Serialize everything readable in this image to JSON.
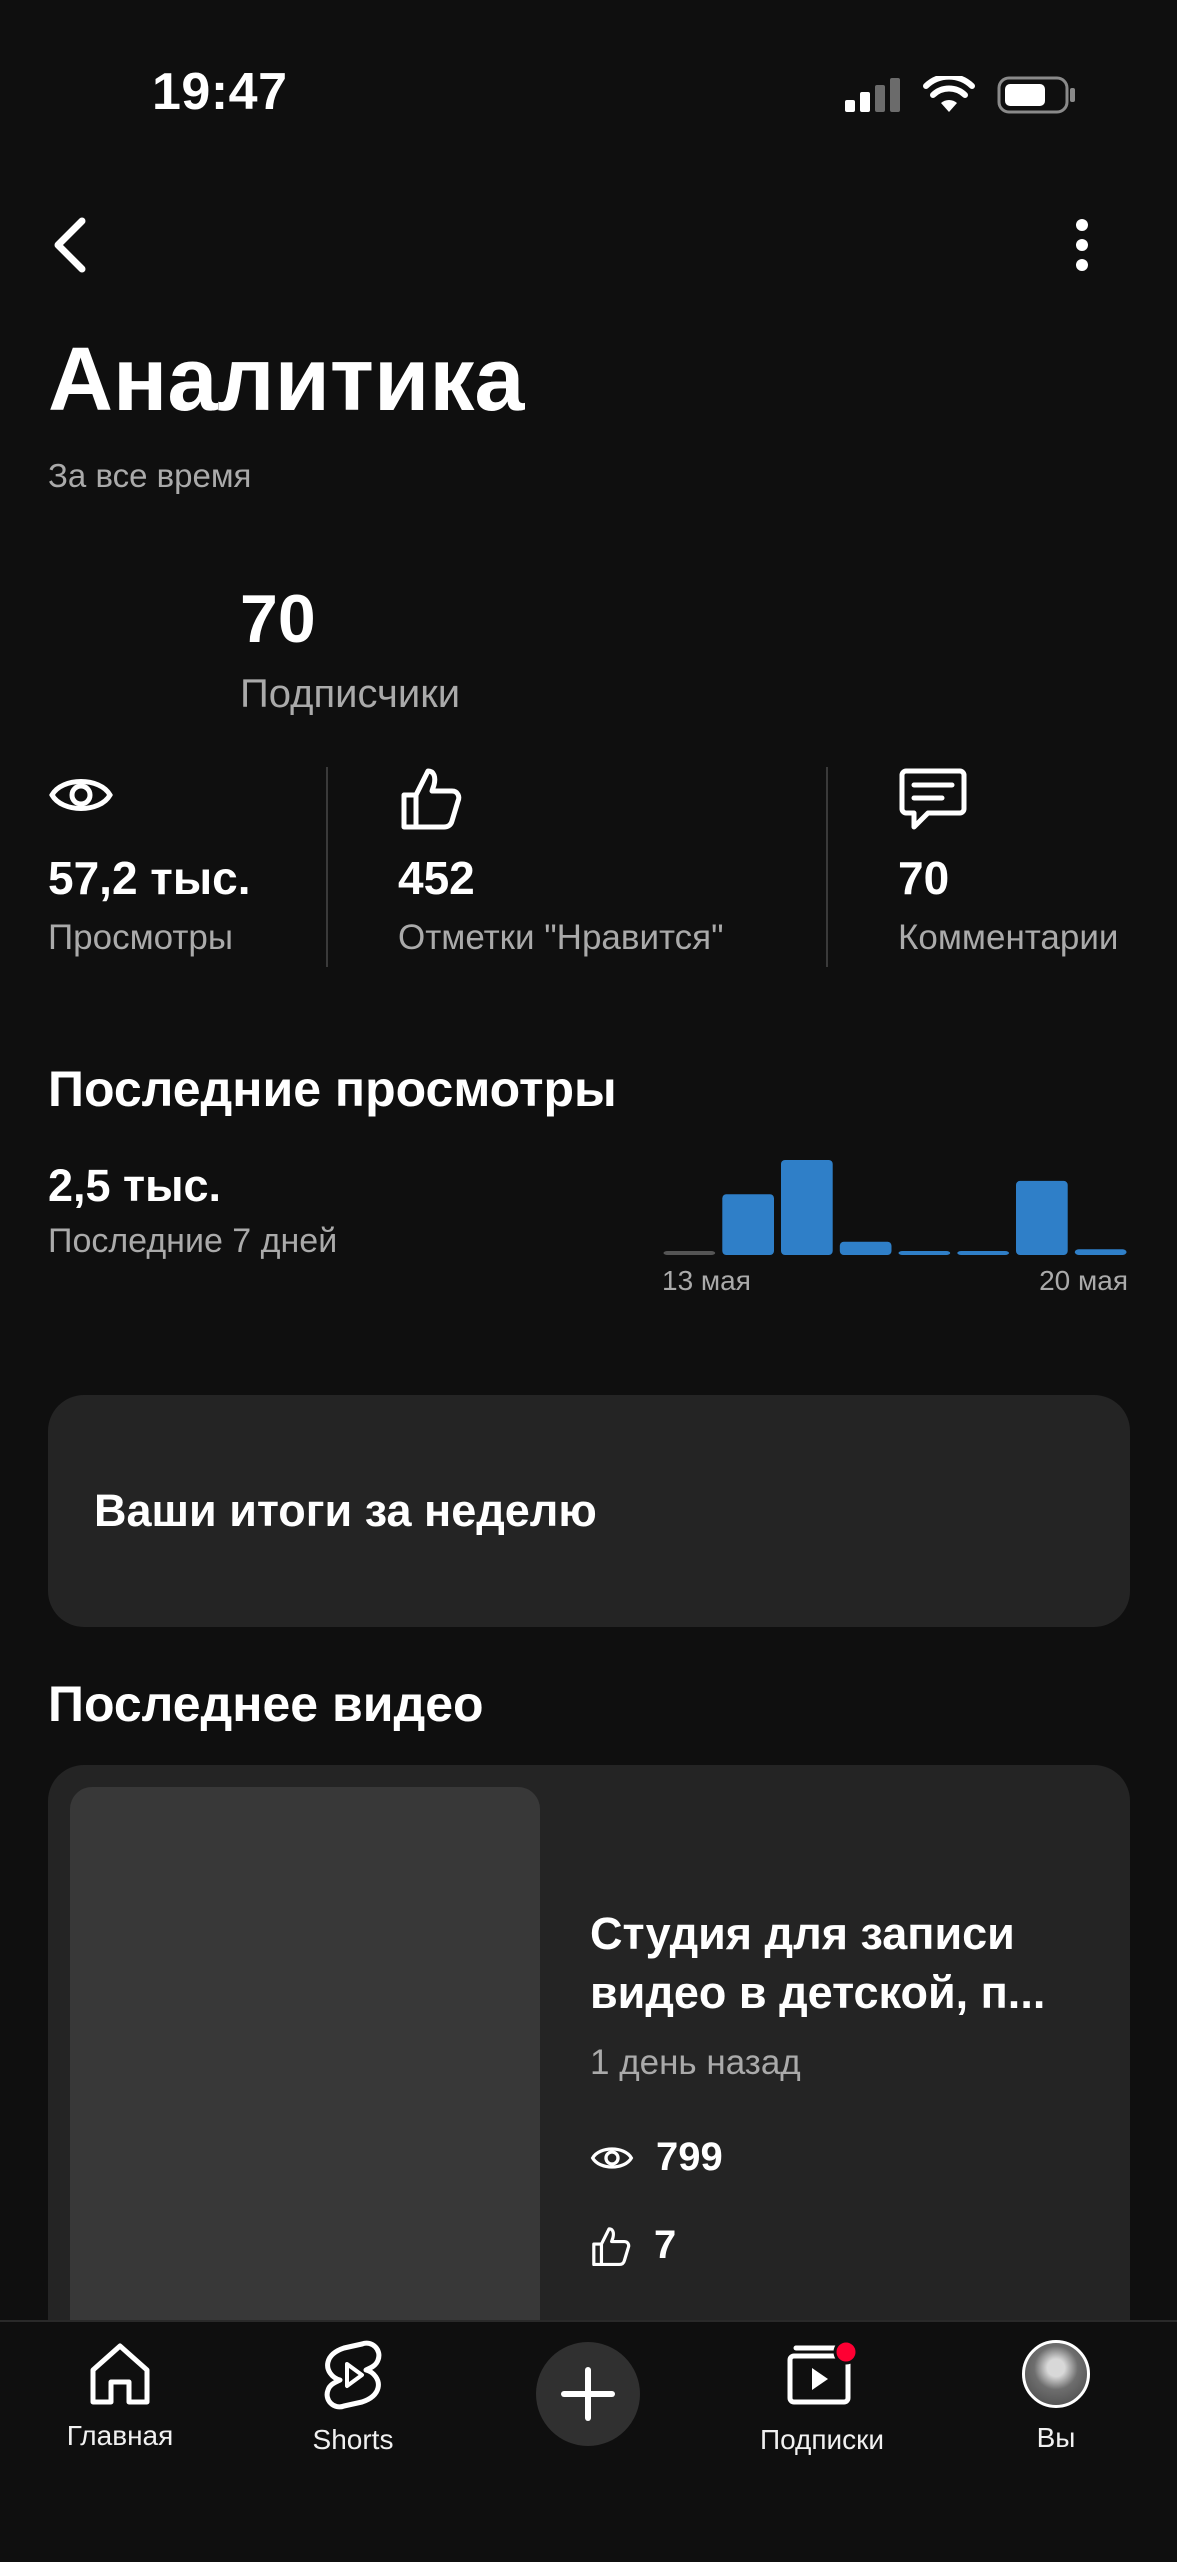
{
  "status_bar": {
    "time": "19:47"
  },
  "header": {
    "title": "Аналитика",
    "subtitle": "За все время"
  },
  "subscribers": {
    "value": "70",
    "label": "Подписчики"
  },
  "stats": [
    {
      "icon": "eye-icon",
      "value": "57,2 тыс.",
      "label": "Просмотры"
    },
    {
      "icon": "thumb-up-icon",
      "value": "452",
      "label": "Отметки \"Нравится\""
    },
    {
      "icon": "comment-icon",
      "value": "70",
      "label": "Комментарии"
    }
  ],
  "recent_views": {
    "title": "Последние просмотры",
    "value": "2,5 тыс.",
    "period": "Последние 7 дней",
    "start_label": "13 мая",
    "end_label": "20 мая"
  },
  "chart_data": {
    "type": "bar",
    "categories": [
      "13 мая",
      "14 мая",
      "15 мая",
      "16 мая",
      "17 мая",
      "18 мая",
      "19 мая",
      "20 мая"
    ],
    "values": [
      0,
      640,
      1000,
      140,
      40,
      40,
      780,
      60
    ],
    "x_tick_labels": [
      "13 мая",
      "20 мая"
    ],
    "bar_color": "#2f7fc8",
    "first_bar_color": "#555555"
  },
  "weekly_summary": {
    "label": "Ваши итоги за неделю"
  },
  "latest_video": {
    "section_title": "Последнее видео",
    "title": "Студия для записи видео в детской, п...",
    "time": "1 день назад",
    "views": "799",
    "likes": "7"
  },
  "bottom_nav": {
    "items": [
      {
        "label": "Главная",
        "icon": "home-icon"
      },
      {
        "label": "Shorts",
        "icon": "shorts-icon"
      },
      {
        "label": "",
        "icon": "plus-icon"
      },
      {
        "label": "Подписки",
        "icon": "subscriptions-icon"
      },
      {
        "label": "Вы",
        "icon": "avatar"
      }
    ],
    "notification_color": "#ff0033"
  },
  "colors": {
    "background": "#0f0f0f",
    "card": "#242424",
    "accent_blue": "#2f7fc8",
    "secondary_text": "#aaaaaa"
  }
}
